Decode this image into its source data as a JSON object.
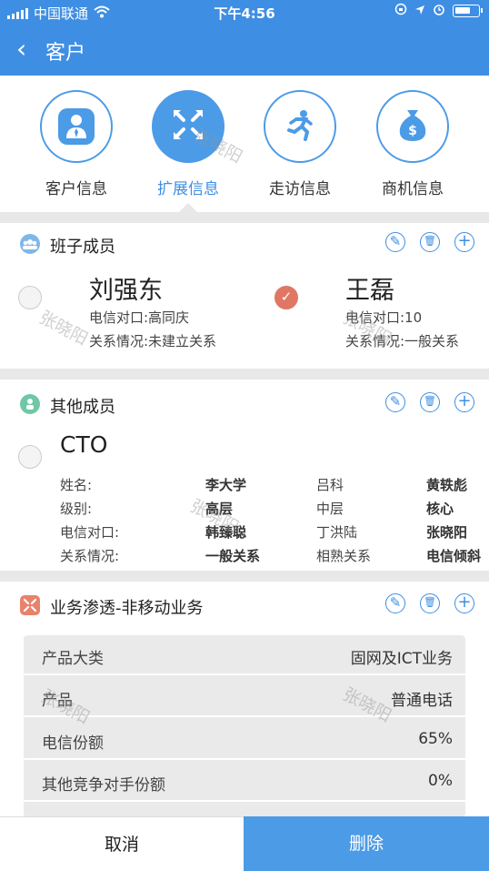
{
  "status": {
    "carrier": "中国联通",
    "time": "下午4:56"
  },
  "nav": {
    "back": "‹",
    "title": "客户"
  },
  "tabs": [
    {
      "label": "客户信息",
      "icon": "person-icon"
    },
    {
      "label": "扩展信息",
      "icon": "expand-icon"
    },
    {
      "label": "走访信息",
      "icon": "runner-icon"
    },
    {
      "label": "商机信息",
      "icon": "money-bag-icon"
    }
  ],
  "active_tab": 1,
  "sections": {
    "team": {
      "title": "班子成员",
      "members": [
        {
          "name": "刘强东",
          "contact": "电信对口:高同庆",
          "relation": "关系情况:未建立关系",
          "checked": false
        },
        {
          "name": "王磊",
          "contact": "电信对口:10",
          "relation": "关系情况:一般关系",
          "checked": true
        }
      ]
    },
    "others": {
      "title": "其他成员",
      "group": "CTO",
      "row_labels": [
        "姓名:",
        "级别:",
        "电信对口:",
        "关系情况:"
      ],
      "columns": [
        [
          "李大学",
          "高层",
          "韩臻聪",
          "一般关系"
        ],
        [
          "吕科",
          "中层",
          "丁洪陆",
          "相熟关系"
        ],
        [
          "黄轶彪",
          "核心",
          "张晓阳",
          "电信倾斜"
        ]
      ]
    },
    "business": {
      "title": "业务渗透-非移动业务",
      "rows": [
        {
          "key": "产品大类",
          "value": "固网及ICT业务"
        },
        {
          "key": "产品",
          "value": "普通电话"
        },
        {
          "key": "电信份额",
          "value": "65%"
        },
        {
          "key": "其他竞争对手份额",
          "value": "0%"
        }
      ]
    }
  },
  "actions": {
    "edit": "✎",
    "delete": "🗑",
    "add": "+"
  },
  "watermark": "张晓阳",
  "bottom": {
    "cancel": "取消",
    "delete": "删除"
  },
  "colors": {
    "primary": "#3e8ee3",
    "check": "#e07764",
    "divider": "#e8e8e8"
  }
}
